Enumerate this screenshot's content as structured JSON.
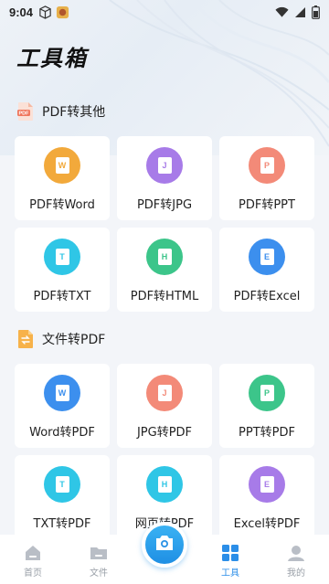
{
  "status": {
    "time": "9:04"
  },
  "page": {
    "title": "工具箱"
  },
  "colors": {
    "orange": "#f2a93b",
    "purple": "#a77be8",
    "salmon": "#f38a78",
    "cyan": "#2fc6e6",
    "green": "#3cc58a",
    "blue": "#3c8fee",
    "accent": "#2b8ee8"
  },
  "section1": {
    "title": "PDF转其他",
    "icon": "pdf-file-icon",
    "items": [
      {
        "label": "PDF转Word",
        "letter": "W",
        "color": "orange"
      },
      {
        "label": "PDF转JPG",
        "letter": "J",
        "color": "purple"
      },
      {
        "label": "PDF转PPT",
        "letter": "P",
        "color": "salmon"
      },
      {
        "label": "PDF转TXT",
        "letter": "T",
        "color": "cyan"
      },
      {
        "label": "PDF转HTML",
        "letter": "H",
        "color": "green"
      },
      {
        "label": "PDF转Excel",
        "letter": "E",
        "color": "blue"
      }
    ]
  },
  "section2": {
    "title": "文件转PDF",
    "icon": "convert-file-icon",
    "items": [
      {
        "label": "Word转PDF",
        "letter": "W",
        "color": "blue"
      },
      {
        "label": "JPG转PDF",
        "letter": "J",
        "color": "salmon"
      },
      {
        "label": "PPT转PDF",
        "letter": "P",
        "color": "green"
      },
      {
        "label": "TXT转PDF",
        "letter": "T",
        "color": "cyan"
      },
      {
        "label": "网页转PDF",
        "letter": "H",
        "color": "cyan"
      },
      {
        "label": "Excel转PDF",
        "letter": "E",
        "color": "purple"
      }
    ]
  },
  "nav": {
    "home": "首页",
    "files": "文件",
    "tools": "工具",
    "mine": "我的"
  }
}
